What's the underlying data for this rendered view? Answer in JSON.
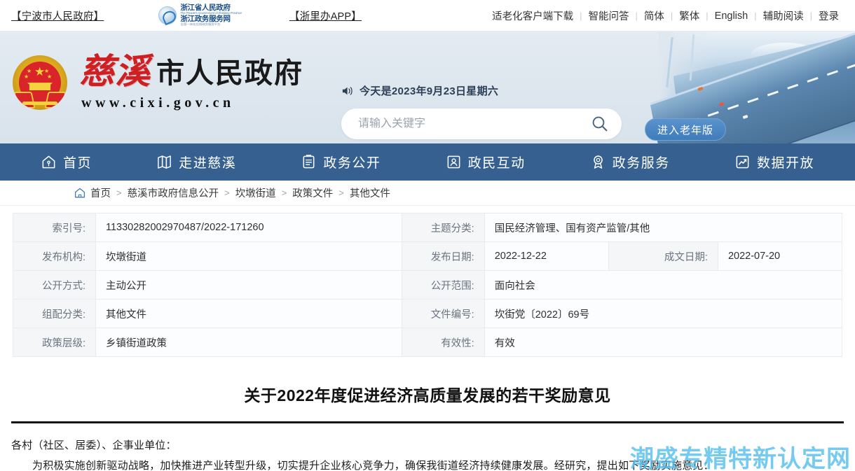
{
  "topbar": {
    "left_link": "【宁波市人民政府】",
    "zj_logo": {
      "line1": "浙江省人民政府",
      "line1_sub": "The People's Government of Zhejiang Province",
      "line2": "浙江政务服务网",
      "line2_sub": "全国一体化在线政务服务平台"
    },
    "app_link": "【浙里办APP】",
    "right_links": [
      "适老化客户端下载",
      "智能问答",
      "简体",
      "繁体",
      "English",
      "辅助阅读",
      "登录"
    ],
    "separator": "|"
  },
  "header": {
    "site_name_red": "慈溪",
    "site_name_black": "市人民政府",
    "site_url": "www.cixi.gov.cn",
    "date_text": "今天是2023年9月23日星期六",
    "speaker_icon": "speaker-icon",
    "search": {
      "placeholder": "请输入关键字",
      "value": "",
      "icon": "search-icon"
    },
    "elder_button": "进入老年版",
    "banner_image": "hangzhou-bay-bridge-photo"
  },
  "mainnav": {
    "items": [
      {
        "label": "首页",
        "icon": "home-icon"
      },
      {
        "label": "走进慈溪",
        "icon": "map-icon"
      },
      {
        "label": "政务公开",
        "icon": "clipboard-icon"
      },
      {
        "label": "政民互动",
        "icon": "user-card-icon"
      },
      {
        "label": "政务服务",
        "icon": "award-icon"
      },
      {
        "label": "数据开放",
        "icon": "chart-icon"
      }
    ]
  },
  "breadcrumb": {
    "home_icon": "home-outline-icon",
    "separator": ">",
    "items": [
      "首页",
      "慈溪市政府信息公开",
      "坎墩街道",
      "政策文件",
      "其他文件"
    ]
  },
  "infotable": {
    "rows": [
      {
        "cells": [
          {
            "label": "索引号:",
            "value": "11330282002970487/2022-171260",
            "colspan": 3
          },
          {
            "label": "主题分类:",
            "value": "国民经济管理、国有资产监管/其他",
            "colspan": 3
          }
        ]
      },
      {
        "cells": [
          {
            "label": "发布机构:",
            "value": "坎墩街道",
            "colspan": 3
          },
          {
            "label": "发布日期:",
            "value": "2022-12-22",
            "colspan": 1
          },
          {
            "label": "成文日期:",
            "value": "2022-07-20",
            "colspan": 1
          }
        ]
      },
      {
        "cells": [
          {
            "label": "公开方式:",
            "value": "主动公开",
            "colspan": 3
          },
          {
            "label": "公开范围:",
            "value": "面向社会",
            "colspan": 3
          }
        ]
      },
      {
        "cells": [
          {
            "label": "组配分类:",
            "value": "其他文件",
            "colspan": 3
          },
          {
            "label": "文件编号:",
            "value": "坎街党〔2022〕69号",
            "colspan": 3
          }
        ]
      },
      {
        "cells": [
          {
            "label": "政策层级:",
            "value": "乡镇街道政策",
            "colspan": 3
          },
          {
            "label": "有效性:",
            "value": "有效",
            "colspan": 3
          }
        ]
      }
    ]
  },
  "article": {
    "title": "关于2022年度促进经济高质量发展的若干奖励意见",
    "paragraph_1": "各村（社区、居委）、企事业单位：",
    "paragraph_2": "为积极实施创新驱动战略，加快推进产业转型升级，切实提升企业核心竞争力，确保我街道经济持续健康发展。经研究，提出如下奖励实施意见："
  },
  "watermark": {
    "text": "潮盛专精特新认定网",
    "color": "#57c0ec"
  },
  "colors": {
    "nav_blue": "#35608f",
    "header_bg": "#dfe7ee",
    "emblem_red": "#d9252a",
    "emblem_gold": "#d9a81e",
    "title_red": "#cf1f22",
    "watermark_blue": "#57c0ec"
  }
}
